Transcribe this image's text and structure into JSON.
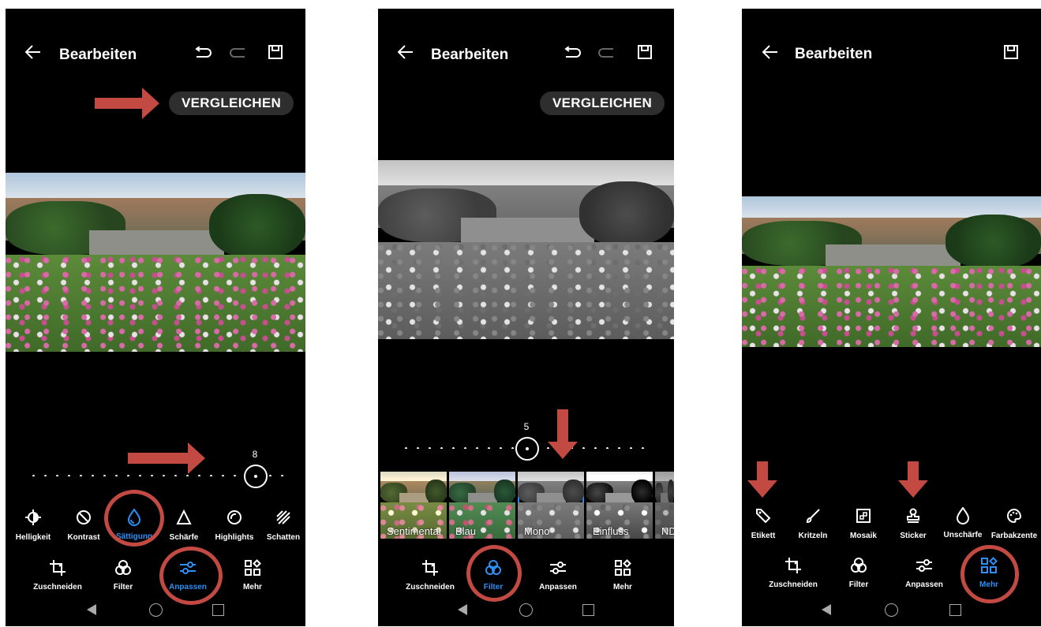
{
  "accent": "#2d8ff5",
  "annotation_color": "#c24a43",
  "screens": [
    {
      "title": "Bearbeiten",
      "compare_label": "VERGLEICHEN",
      "slider_value": "8",
      "adjust_tools": [
        "Helligkeit",
        "Kontrast",
        "Sättigung",
        "Schärfe",
        "Highlights",
        "Schatten"
      ],
      "selected_adjust_tool": "Sättigung",
      "tabs": [
        "Zuschneiden",
        "Filter",
        "Anpassen",
        "Mehr"
      ],
      "selected_tab": "Anpassen"
    },
    {
      "title": "Bearbeiten",
      "compare_label": "VERGLEICHEN",
      "slider_value": "5",
      "filters": [
        "Sentimental",
        "Blau",
        "Mono",
        "Einfluss",
        "ND"
      ],
      "selected_filter": "Mono",
      "tabs": [
        "Zuschneiden",
        "Filter",
        "Anpassen",
        "Mehr"
      ],
      "selected_tab": "Filter"
    },
    {
      "title": "Bearbeiten",
      "more_tools": [
        "Etikett",
        "Kritzeln",
        "Mosaik",
        "Sticker",
        "Unschärfe",
        "Farbakzente"
      ],
      "tabs": [
        "Zuschneiden",
        "Filter",
        "Anpassen",
        "Mehr"
      ],
      "selected_tab": "Mehr"
    }
  ]
}
